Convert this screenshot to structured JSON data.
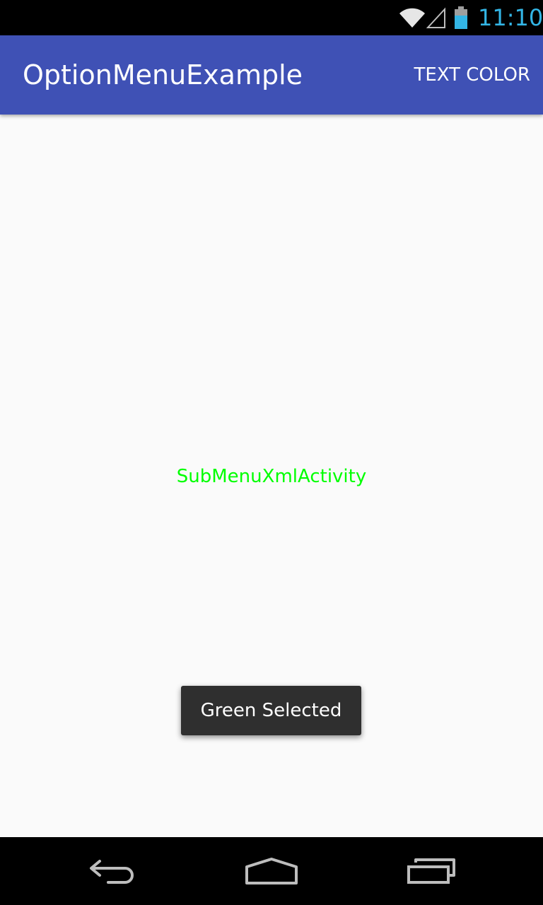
{
  "status_bar": {
    "time": "11:10",
    "icons": [
      "wifi-icon",
      "signal-icon",
      "battery-icon"
    ],
    "clock_color": "#33b5e5"
  },
  "app_bar": {
    "title": "OptionMenuExample",
    "menu_action_label": "TEXT COLOR",
    "color": "#3f51b5"
  },
  "content": {
    "center_text": "SubMenuXmlActivity",
    "center_text_color": "#00ff00"
  },
  "toast": {
    "message": "Green Selected"
  },
  "nav_bar": {
    "buttons": [
      "back-icon",
      "home-icon",
      "recents-icon"
    ]
  }
}
